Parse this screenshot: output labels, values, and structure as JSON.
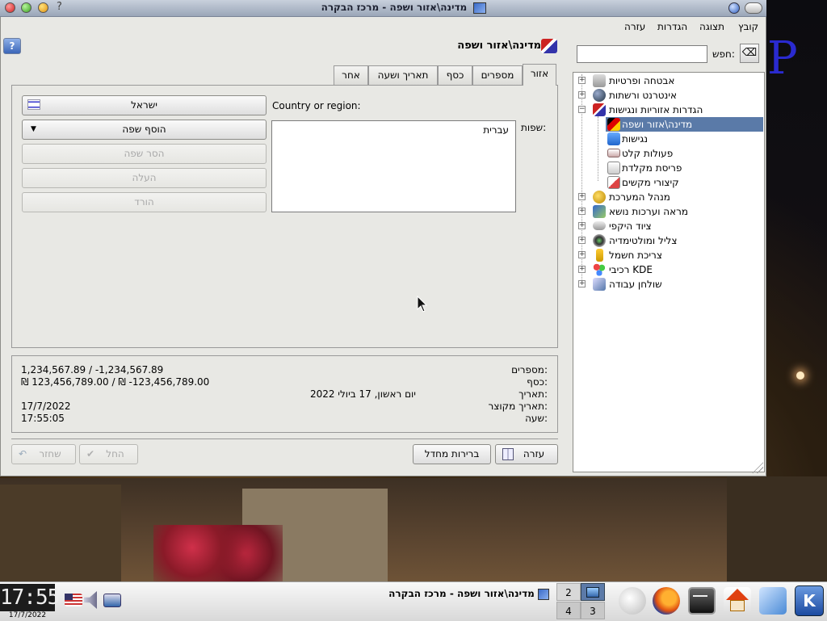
{
  "window": {
    "title": "מדינה\\אזור ושפה - מרכז הבקרה",
    "help_glyph": "?",
    "close_glyph": "✕"
  },
  "menubar": {
    "file": "קובץ",
    "view": "תצוגה",
    "settings": "הגדרות",
    "help": "עזרה"
  },
  "search": {
    "label": "חפש:",
    "value": ""
  },
  "tree": {
    "items": [
      {
        "label": "אבטחה ופרטיות",
        "expander": "+",
        "icon": "lock-icon"
      },
      {
        "label": "אינטרנט ורשתות",
        "expander": "+",
        "icon": "globe-icon"
      },
      {
        "label": "הגדרות אזוריות ונגישות",
        "expander": "−",
        "icon": "flags-icon"
      },
      {
        "label": "מדינה\\אזור ושפה",
        "icon": "flag-icon",
        "selected": true
      },
      {
        "label": "נגישות",
        "icon": "accessibility-icon"
      },
      {
        "label": "פעולות קלט",
        "icon": "input-icon"
      },
      {
        "label": "פריסת מקלדת",
        "icon": "keyboard-icon"
      },
      {
        "label": "קיצורי מקשים",
        "icon": "shortcut-icon"
      },
      {
        "label": "מנהל המערכת",
        "expander": "+",
        "icon": "admin-icon"
      },
      {
        "label": "מראה וערכות נושא",
        "expander": "+",
        "icon": "appearance-icon"
      },
      {
        "label": "ציוד היקפי",
        "expander": "+",
        "icon": "peripherals-icon"
      },
      {
        "label": "צליל ומולטימדיה",
        "expander": "+",
        "icon": "sound-icon"
      },
      {
        "label": "צריכת חשמל",
        "expander": "+",
        "icon": "power-icon"
      },
      {
        "label": "רכיבי KDE",
        "expander": "+",
        "icon": "kde-components-icon"
      },
      {
        "label": "שולחן עבודה",
        "expander": "+",
        "icon": "desktop-icon"
      }
    ]
  },
  "page": {
    "title": "מדינה\\אזור ושפה",
    "help_button": "?"
  },
  "tabs": [
    {
      "label": "אזור",
      "active": true
    },
    {
      "label": "מספרים"
    },
    {
      "label": "כסף"
    },
    {
      "label": "תאריך ושעה"
    },
    {
      "label": "אחר"
    }
  ],
  "region": {
    "country_label": "Country or region:",
    "country_value": "ישראל",
    "languages_label": "שפות:",
    "languages": [
      "עברית"
    ],
    "add_language": "הוסף שפה",
    "remove_language": "הסר שפה",
    "move_up": "העלה",
    "move_down": "הורד"
  },
  "summary": {
    "numbers_label": "מספרים:",
    "numbers_value": "1,234,567.89 / -1,234,567.89",
    "money_label": "כסף:",
    "money_value": "₪ 123,456,789.00 / ₪ -123,456,789.00",
    "date_label": "תאריך:",
    "date_value": "יום ראשון, 17 ביולי 2022",
    "short_date_label": "תאריך מקוצר:",
    "short_date_value": "17/7/2022",
    "time_label": "שעה:",
    "time_value": "17:55:05"
  },
  "buttons": {
    "help": "עזרה",
    "defaults": "ברירות מחדל",
    "apply": "החל",
    "reset": "שחזר"
  },
  "taskbar": {
    "clock": "17:55",
    "date": "17/7/2022",
    "pager": [
      "2",
      "3",
      "4"
    ],
    "task_title": "מדינה\\אזור ושפה - מרכז הבקרה"
  },
  "colors": {
    "selection": "#5a7aa8",
    "window_bg": "#e8e8e4"
  }
}
